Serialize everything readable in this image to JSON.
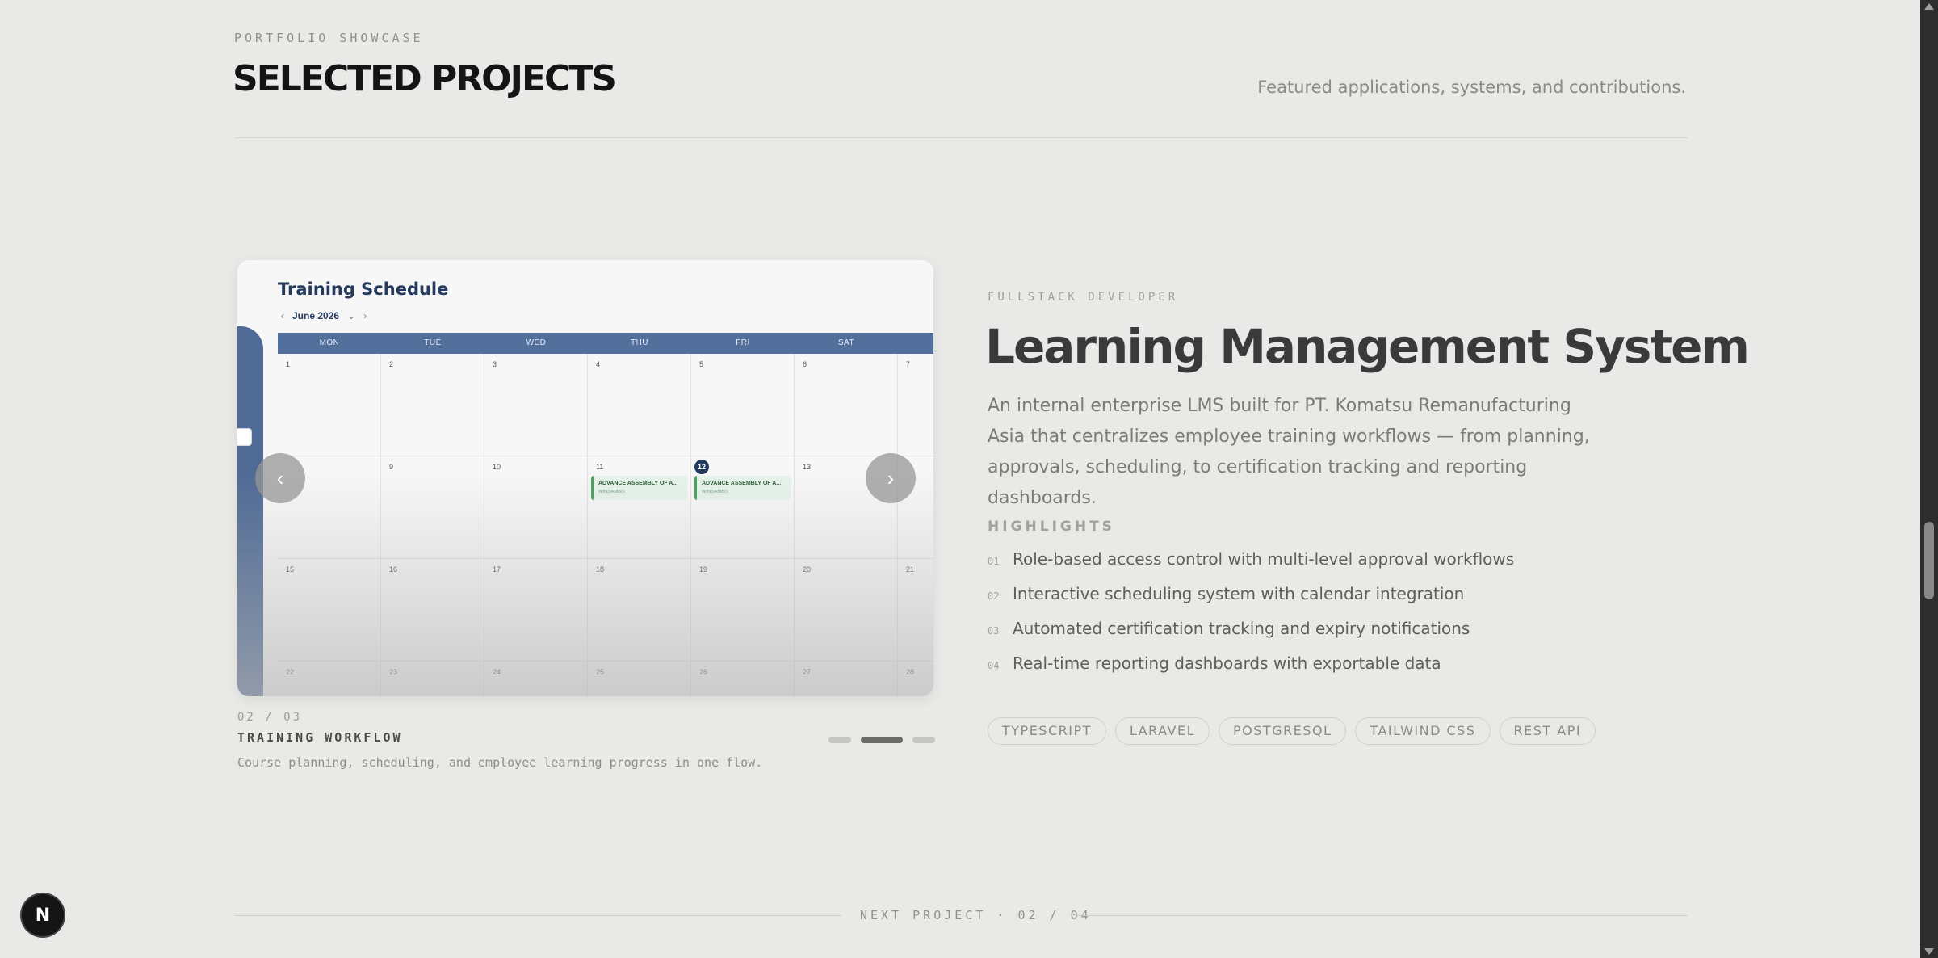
{
  "section": {
    "eyebrow": "PORTFOLIO SHOWCASE",
    "title": "SELECTED PROJECTS",
    "subtitle": "Featured applications, systems, and contributions."
  },
  "screenshot": {
    "title": "Training Schedule",
    "month": "June 2026",
    "weekdays": [
      "MON",
      "TUE",
      "WED",
      "THU",
      "FRI",
      "SAT",
      ""
    ],
    "days": [
      "1",
      "2",
      "3",
      "4",
      "5",
      "6",
      "7",
      "",
      "9",
      "10",
      "11",
      "12",
      "13",
      "",
      "15",
      "16",
      "17",
      "18",
      "19",
      "20",
      "21",
      "22",
      "23",
      "24",
      "25",
      "26",
      "27",
      "28"
    ],
    "today": "12",
    "events": [
      {
        "day": "11",
        "label": "ADVANCE ASSEMBLY OF A...",
        "sub": "WINDAMBO"
      },
      {
        "day": "12",
        "label": "ADVANCE ASSEMBLY OF A...",
        "sub": "WINDAMBO"
      }
    ]
  },
  "carousel": {
    "counter": "02 / 03",
    "slide_title": "TRAINING WORKFLOW",
    "slide_desc": "Course planning, scheduling, and employee learning progress in one flow.",
    "prev_icon": "chevron-left-icon",
    "next_icon": "chevron-right-icon",
    "active_index": 1,
    "total": 3
  },
  "project": {
    "role": "FULLSTACK DEVELOPER",
    "title": "Learning Management System",
    "description": "An internal enterprise LMS built for PT. Komatsu Remanufacturing Asia that centralizes employee training workflows — from planning, approvals, scheduling, to certification tracking and reporting dashboards.",
    "highlights_label": "HIGHLIGHTS",
    "highlights": [
      {
        "num": "01",
        "text": "Role-based access control with multi-level approval workflows"
      },
      {
        "num": "02",
        "text": "Interactive scheduling system with calendar integration"
      },
      {
        "num": "03",
        "text": "Automated certification tracking and expiry notifications"
      },
      {
        "num": "04",
        "text": "Real-time reporting dashboards with exportable data"
      }
    ],
    "tags": [
      "TYPESCRIPT",
      "LARAVEL",
      "POSTGRESQL",
      "TAILWIND CSS",
      "REST API"
    ]
  },
  "next_project": "NEXT PROJECT · 02 / 04",
  "fab": {
    "label": "N",
    "icon": "nextjs-logo-icon"
  },
  "colors": {
    "background": "#e9e9e7",
    "calendar_header": "#53709c",
    "event_green": "#43a35f",
    "scrollbar": "#2d2d2d"
  }
}
